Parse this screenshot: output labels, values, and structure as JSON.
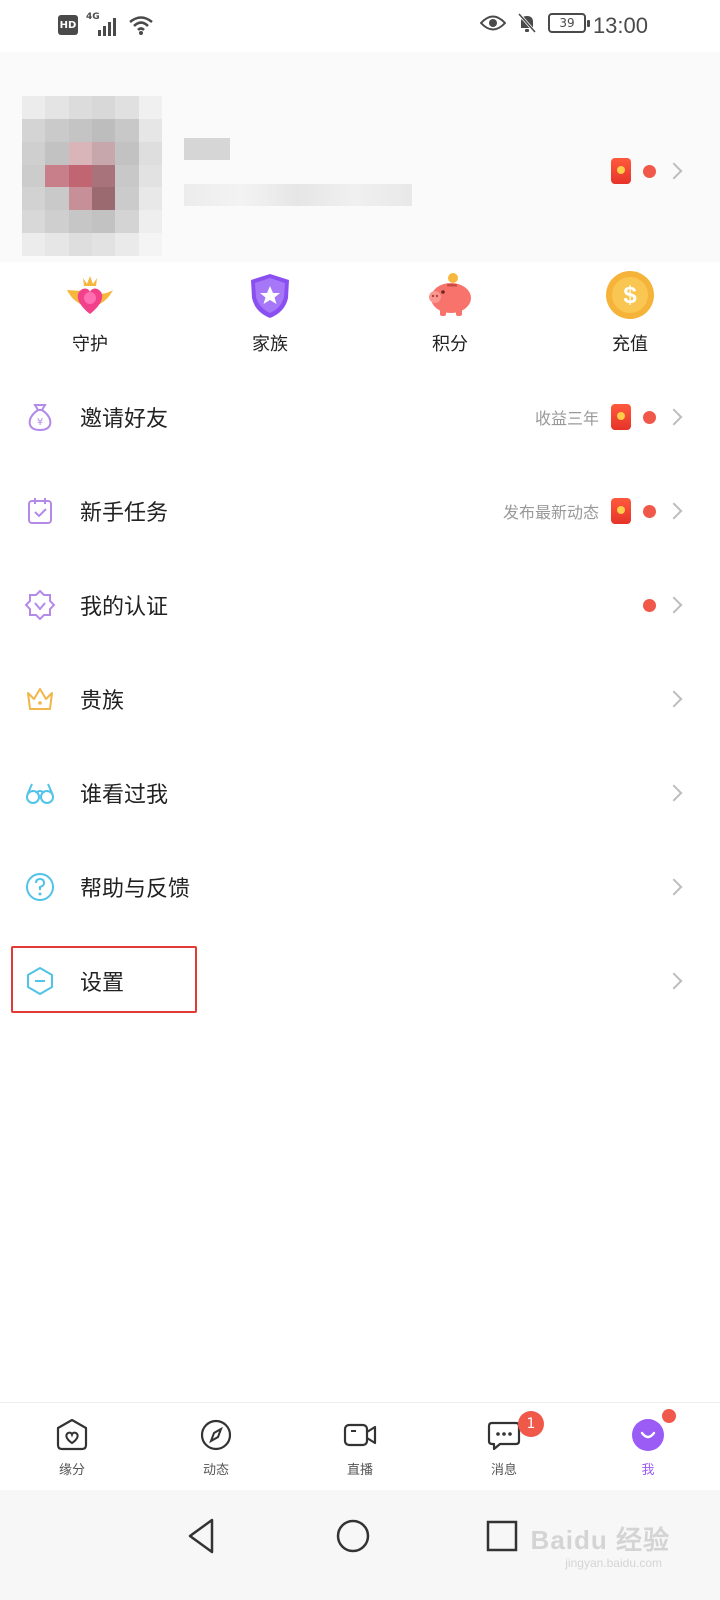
{
  "status_bar": {
    "network_badge": "HD",
    "network_type": "4G",
    "battery_level": "39",
    "time": "13:00"
  },
  "quick_actions": [
    {
      "label": "守护",
      "icon": "heart-crown-icon"
    },
    {
      "label": "家族",
      "icon": "star-shield-icon"
    },
    {
      "label": "积分",
      "icon": "piggy-bank-icon"
    },
    {
      "label": "充值",
      "icon": "dollar-coin-icon"
    }
  ],
  "menu": [
    {
      "label": "邀请好友",
      "hint": "收益三年",
      "icon": "money-bag-icon",
      "red_packet": true,
      "red_dot": true
    },
    {
      "label": "新手任务",
      "hint": "发布最新动态",
      "icon": "calendar-check-icon",
      "red_packet": true,
      "red_dot": true
    },
    {
      "label": "我的认证",
      "hint": "",
      "icon": "verified-badge-icon",
      "red_packet": false,
      "red_dot": true
    },
    {
      "label": "贵族",
      "hint": "",
      "icon": "crown-icon",
      "red_packet": false,
      "red_dot": false
    },
    {
      "label": "谁看过我",
      "hint": "",
      "icon": "glasses-icon",
      "red_packet": false,
      "red_dot": false
    },
    {
      "label": "帮助与反馈",
      "hint": "",
      "icon": "question-circle-icon",
      "red_packet": false,
      "red_dot": false
    },
    {
      "label": "设置",
      "hint": "",
      "icon": "settings-hexagon-icon",
      "red_packet": false,
      "red_dot": false
    }
  ],
  "tabs": [
    {
      "label": "缘分",
      "icon": "heart-house-icon",
      "active": false
    },
    {
      "label": "动态",
      "icon": "compass-icon",
      "active": false
    },
    {
      "label": "直播",
      "icon": "video-camera-icon",
      "active": false
    },
    {
      "label": "消息",
      "icon": "chat-bubble-icon",
      "active": false,
      "badge": "1"
    },
    {
      "label": "我",
      "icon": "smile-face-icon",
      "active": true,
      "dot": true
    }
  ],
  "watermark": {
    "brand": "Baidu 经验",
    "url": "jingyan.baidu.com"
  },
  "colors": {
    "accent": "#9b5cf5",
    "red": "#f0584a",
    "highlight_border": "#e23a34"
  }
}
